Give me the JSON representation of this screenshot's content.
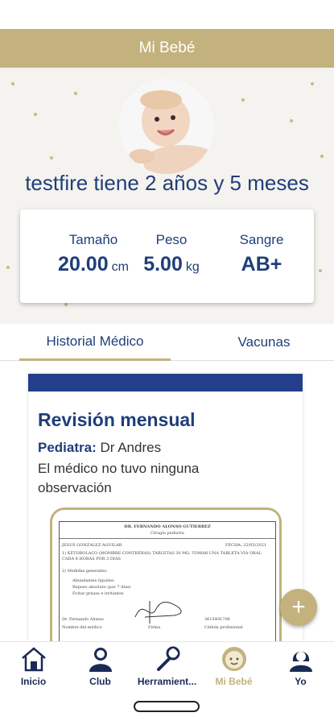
{
  "header": {
    "title": "Mi Bebé"
  },
  "baby": {
    "summary": "testfire tiene 2 años y 5 meses"
  },
  "stats": [
    {
      "label": "Tamaño",
      "value": "20.00",
      "unit": "cm"
    },
    {
      "label": "Peso",
      "value": "5.00",
      "unit": "kg"
    },
    {
      "label": "Sangre",
      "value": "AB+",
      "unit": ""
    }
  ],
  "tabs": [
    {
      "label": "Historial Médico",
      "active": true
    },
    {
      "label": "Vacunas",
      "active": false
    }
  ],
  "record": {
    "title": "Revisión mensual",
    "doctor_label": "Pediatra:",
    "doctor_name": "Dr Andres",
    "note": "El médico no tuvo ninguna observación",
    "document": {
      "header": "DR. FERNANDO ALONSO GUTIERREZ",
      "subheader": "Cirugía pediatra",
      "patient": "JESUS GONZALEZ AGUILAR",
      "date": "FECHA: 22/05/2021",
      "rx": "1) KETOROLACO (MOMBRE CONTRERAS) TABLETAS 30 MG. TOMAR UNA TABLETA VIA ORAL CADA 8 HORAS POR 3 DIAS",
      "general": "2) Medidas generales:",
      "items": [
        "Abundantes líquidos",
        "Reposo absoluto (por 7 días)",
        "Evitar grasas e irritantes"
      ],
      "footer_left": "Dr. Fernando Alonso",
      "footer_left_sub": "Nombre del médico",
      "footer_mid": "Firma",
      "footer_right": "3615491706",
      "footer_right_sub": "Cédula profesional"
    }
  },
  "fab": {
    "icon": "plus-icon",
    "label": "+"
  },
  "nav": [
    {
      "label": "Inicio",
      "icon": "house-icon",
      "active": false
    },
    {
      "label": "Club",
      "icon": "person-icon",
      "active": false
    },
    {
      "label": "Herramient...",
      "icon": "wrench-icon",
      "active": false
    },
    {
      "label": "Mi Bebé",
      "icon": "baby-face-icon",
      "active": true
    },
    {
      "label": "Yo",
      "icon": "woman-icon",
      "active": false
    }
  ],
  "colors": {
    "gold": "#c3b27d",
    "navy": "#1f3e7a",
    "record_bar": "#233e8b"
  }
}
